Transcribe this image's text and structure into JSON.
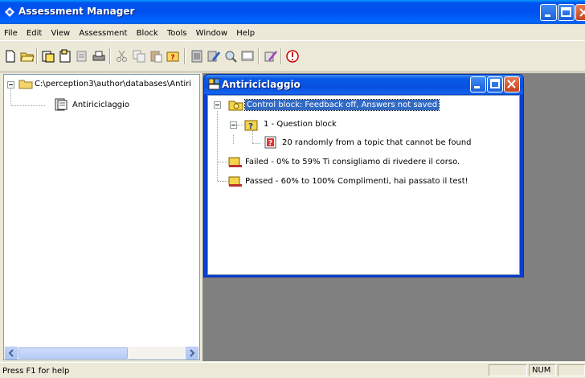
{
  "window": {
    "title": "Assessment Manager"
  },
  "menu": [
    {
      "label": "File"
    },
    {
      "label": "Edit"
    },
    {
      "label": "View"
    },
    {
      "label": "Assessment"
    },
    {
      "label": "Block"
    },
    {
      "label": "Tools"
    },
    {
      "label": "Window"
    },
    {
      "label": "Help"
    }
  ],
  "toolbar": [
    {
      "icon": "new-document-icon"
    },
    {
      "icon": "open-folder-icon"
    },
    {
      "icon": "new-block-icon"
    },
    {
      "icon": "new-question-icon"
    },
    {
      "icon": "print-preview-icon"
    },
    {
      "icon": "print-icon"
    },
    {
      "icon": "cut-icon"
    },
    {
      "icon": "copy-icon"
    },
    {
      "icon": "paste-icon"
    },
    {
      "icon": "insert-question-icon"
    },
    {
      "icon": "properties-icon"
    },
    {
      "icon": "edit-question-icon"
    },
    {
      "icon": "find-icon"
    },
    {
      "icon": "preview-icon"
    },
    {
      "icon": "assessment-wizard-icon"
    },
    {
      "icon": "info-icon"
    }
  ],
  "left_tree": {
    "root_path": "C:\\perception3\\author\\databases\\Antiri",
    "child_label": "Antiriciclaggio"
  },
  "child_window": {
    "title": "Antiriciclaggio",
    "nodes": {
      "control_block": "Control block: Feedback off, Answers not saved",
      "question_block": "1 - Question block",
      "random_questions": "20 randomly from a topic that cannot be found",
      "failed": "Failed - 0% to 59% Ti consigliamo di rivedere il corso.",
      "passed": "Passed - 60% to 100% Complimenti, hai passato il test!"
    }
  },
  "status": {
    "help_text": "Press F1 for help",
    "num": "NUM"
  },
  "colors": {
    "title_blue": "#0053ee",
    "selection": "#316ac5",
    "mdi_background": "#808080"
  }
}
